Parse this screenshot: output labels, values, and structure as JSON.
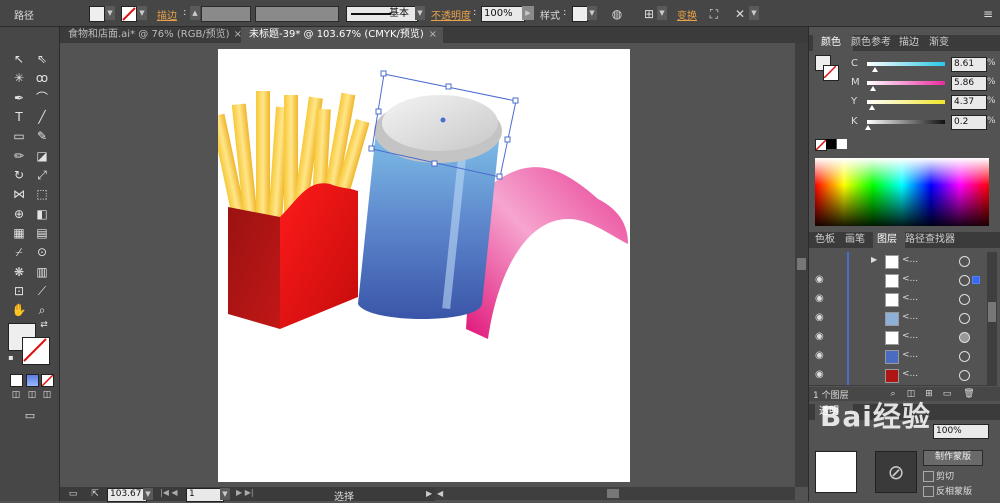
{
  "control_bar": {
    "object_type": "路径",
    "stroke_label": "描边",
    "stroke_style": "基本",
    "opacity_label": "不透明度",
    "opacity_value": "100%",
    "style_label": "样式",
    "transform_label": "变换"
  },
  "document_tabs": [
    {
      "title": "食物和店面.ai* @ 76% (RGB/预览)",
      "close": "×"
    },
    {
      "title": "未标题-39* @ 103.67% (CMYK/预览)",
      "close": "×"
    }
  ],
  "status_bar": {
    "zoom": "103.67",
    "page": "1",
    "tool_name": "选择"
  },
  "color_panel": {
    "tabs": [
      "颜色",
      "颜色参考",
      "描边",
      "渐变"
    ],
    "sliders": [
      {
        "channel": "C",
        "value": "8.61",
        "unit": "%",
        "color": "#29c7e6"
      },
      {
        "channel": "M",
        "value": "5.86",
        "unit": "%",
        "color": "#ea2aa0"
      },
      {
        "channel": "Y",
        "value": "4.37",
        "unit": "%",
        "color": "#f0e62a"
      },
      {
        "channel": "K",
        "value": "0.2",
        "unit": "%",
        "color": "#222222"
      }
    ]
  },
  "layers_panel": {
    "tabs": [
      "色板",
      "画笔",
      "图层",
      "路径查找器"
    ],
    "rows": [
      {
        "name": "<..."
      },
      {
        "name": "<..."
      },
      {
        "name": "<..."
      },
      {
        "name": "<..."
      },
      {
        "name": "<..."
      },
      {
        "name": "<..."
      },
      {
        "name": "<..."
      }
    ],
    "footer_label": "1 个图层"
  },
  "transparency_panel": {
    "tab": "透明",
    "opacity": "100%",
    "mode_button": "制作蒙版",
    "clip_label": "剪切",
    "invert_label": "反相蒙版"
  },
  "watermark": "Bai经验",
  "colors": {
    "ui_dark": "#464646",
    "canvas_bg": "#535353",
    "accent_orange": "#e8a24a",
    "selection_blue": "#4c6bd1"
  }
}
